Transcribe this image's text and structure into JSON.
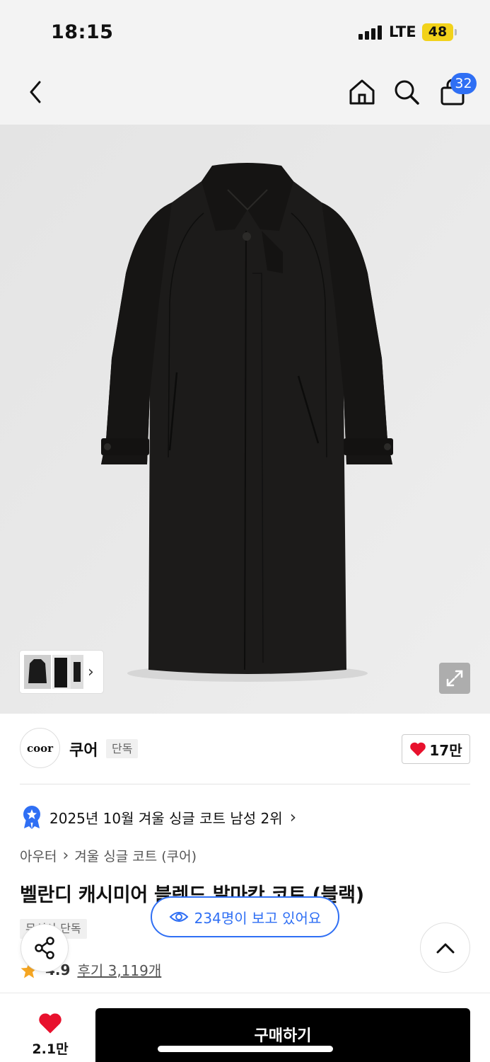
{
  "status_bar": {
    "time": "18:15",
    "network": "LTE",
    "battery": "48"
  },
  "nav": {
    "cart_count": "32",
    "icons": [
      "back-icon",
      "home-icon",
      "search-icon",
      "shopping-bag-icon"
    ]
  },
  "brand": {
    "logo_text": "coor",
    "name": "쿠어",
    "tag": "단독",
    "likes": "17만"
  },
  "ranking": {
    "text": "2025년 10월 겨울 싱글 코트 남성 2위"
  },
  "breadcrumb": {
    "category": "아우터",
    "subcategory": "겨울 싱글 코트 (쿠어)"
  },
  "product": {
    "title": "벨란디 캐시미어 블렌드 발마칸 코트 (블랙)",
    "exclusive_tag": "단독",
    "rating": "4.9",
    "reviews": "후기 3,119개"
  },
  "viewers": {
    "text": "234명이 보고 있어요"
  },
  "bottom": {
    "wish_count": "2.1만",
    "buy_label": "구매하기"
  },
  "colors": {
    "accent": "#2f6ff4",
    "heart": "#e8112d",
    "buy_button": "#000000"
  }
}
